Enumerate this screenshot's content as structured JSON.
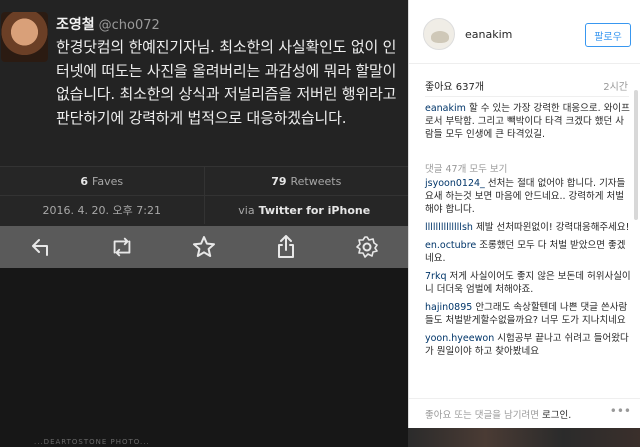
{
  "tweet": {
    "author": "조영철",
    "handle": "@cho072",
    "text": "한경닷컴의 한예진기자님. 최소한의 사실확인도 없이 인터넷에 떠도는 사진을 올려버리는 과감성에 뭐라 할말이 없습니다. 최소한의 상식과 저널리즘을 저버린 행위라고 판단하기에 강력하게 법적으로 대응하겠습니다.",
    "faves_count": "6",
    "faves_label": "Faves",
    "retweets_count": "79",
    "retweets_label": "Retweets",
    "date": "2016. 4. 20. 오후 7:21",
    "via_prefix": "via",
    "via_source": "Twitter for iPhone",
    "icons": [
      "reply-icon",
      "retweet-icon",
      "favorite-icon",
      "share-icon",
      "settings-icon"
    ]
  },
  "bottom_watermark": "...DEARTOSTONE PHOTO...",
  "instagram": {
    "username": "eanakim",
    "follow_label": "팔로우",
    "likes": "좋아요 637개",
    "time": "2시간",
    "caption_user": "eanakim",
    "caption_text": "할 수 있는 가장 강력한 대응으로. 와이프로서 부탁함. 그리고 빽박이다 타격 크겠다 했던 사람들 모두 인생에 큰 타격있길.",
    "view_all": "댓글 47개 모두 보기",
    "comments": [
      {
        "user": "jsyoon0124_",
        "text": "선처는 절대 없어야 합니다. 기자들 요새 하는것 보면 마음에 안드네요.. 강력하게 처벌해야 합니다."
      },
      {
        "user": "llllllllllllllsh",
        "text": "제발 선처따윈없이! 강력대응해주세요!"
      },
      {
        "user": "en.octubre",
        "text": "조롱했던 모두 다 처벌 받았으면 좋겠네요."
      },
      {
        "user": "7rkq",
        "text": "저게 사실이어도 좋지 않은 보돈데 허위사실이니 더더욱 엄벌에 처해야죠."
      },
      {
        "user": "hajin0895",
        "text": "안그래도 속상할텐데 나쁜 댓글 쓴사람들도 처벌받게할수없을까요? 너무 도가 지나치네요"
      },
      {
        "user": "yoon.hyeewon",
        "text": "시험공부 끝나고 쉬려고 들어왔다가 뭔일이야 하고 찾아봤네요"
      }
    ],
    "footer_text": "좋아요 또는 댓글을 남기려면",
    "footer_link": "로그인.",
    "more": "•••"
  }
}
